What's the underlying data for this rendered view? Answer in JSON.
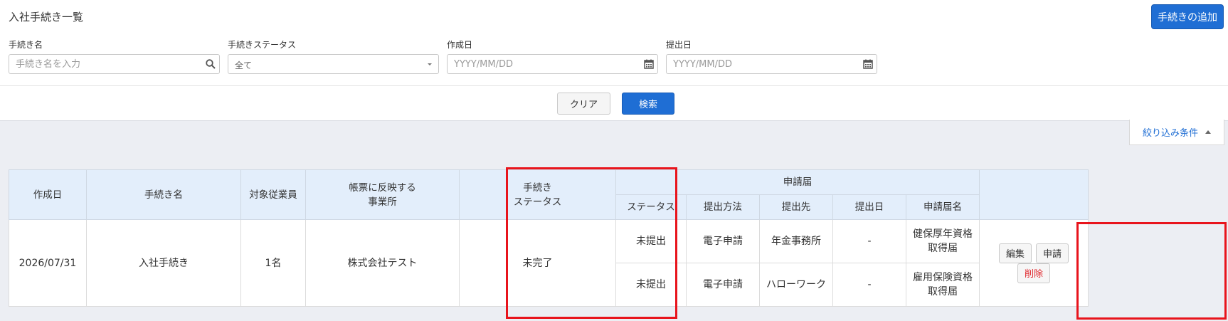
{
  "header": {
    "title": "入社手続き一覧",
    "add_button": "手続きの追加"
  },
  "filters": {
    "name": {
      "label": "手続き名",
      "placeholder": "手続き名を入力"
    },
    "status": {
      "label": "手続きステータス",
      "value": "全て"
    },
    "created": {
      "label": "作成日",
      "placeholder": "YYYY/MM/DD"
    },
    "submitted": {
      "label": "提出日",
      "placeholder": "YYYY/MM/DD"
    }
  },
  "actions": {
    "clear": "クリア",
    "search": "検索",
    "filter_toggle": "絞り込み条件"
  },
  "table": {
    "headers": {
      "created": "作成日",
      "name": "手続き名",
      "employees": "対象従業員",
      "office": "帳票に反映する\n事業所",
      "proc_status": "手続き\nステータス",
      "application_group": "申請届",
      "app_status": "ステータス",
      "method": "提出方法",
      "destination": "提出先",
      "submit_date": "提出日",
      "form_name": "申請届名"
    },
    "row": {
      "created": "2026/07/31",
      "name": "入社手続き",
      "employees": "1名",
      "office": "株式会社テスト",
      "proc_status": "未完了",
      "applications": [
        {
          "status": "未提出",
          "method": "電子申請",
          "destination": "年金事務所",
          "date": "-",
          "form": "健保厚年資格\n取得届"
        },
        {
          "status": "未提出",
          "method": "電子申請",
          "destination": "ハローワーク",
          "date": "-",
          "form": "雇用保険資格\n取得届"
        }
      ],
      "buttons": {
        "edit": "編集",
        "apply": "申請",
        "delete": "削除"
      }
    }
  },
  "colors": {
    "primary": "#1f6ed4",
    "highlight": "#e8141c",
    "header_bg": "#e3eefb"
  }
}
